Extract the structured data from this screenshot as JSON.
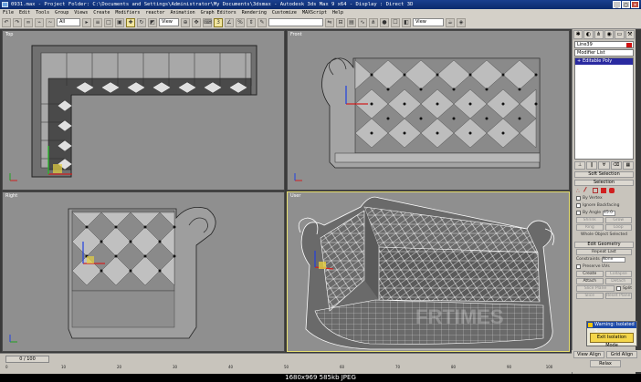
{
  "window": {
    "title": "0931.max  - Project Folder: C:\\Documents and Settings\\Administrator\\My Documents\\3dsmax  - Autodesk 3ds Max 9 x64  - Display : Direct 3D",
    "min": "_",
    "max": "□",
    "close": "×"
  },
  "menu": [
    "File",
    "Edit",
    "Tools",
    "Group",
    "Views",
    "Create",
    "Modifiers",
    "reactor",
    "Animation",
    "Graph Editors",
    "Rendering",
    "Customize",
    "MAXScript",
    "Help"
  ],
  "toolbar": {
    "selection_filter": "All",
    "ref_coord": "View",
    "named_sel": "",
    "ref_coord_2": "View"
  },
  "viewports": {
    "top": "Top",
    "front": "Front",
    "left": "Right",
    "perspective": "User"
  },
  "command_panel": {
    "object_name": "Line39",
    "modifier_list": "Modifier List",
    "stack_item": "Editable Poly",
    "rollouts": {
      "soft_selection": "Soft Selection",
      "selection": "Selection",
      "by_vertex": "By Vertex",
      "ignore_backfacing": "Ignore Backfacing",
      "by_angle": "By Angle",
      "angle_value": "45.0",
      "shrink": "Shrink",
      "grow": "Grow",
      "ring": "Ring",
      "loop": "Loop",
      "whole_object": "Whole Object Selected",
      "edit_geometry": "Edit Geometry",
      "repeat_last": "Repeat Last",
      "constraints": "Constraints",
      "constraints_value": "None",
      "preserve_uvs": "Preserve UVs",
      "create": "Create",
      "collapse": "Collapse",
      "attach": "Attach",
      "detach": "Detach",
      "slice_plane": "Slice Plane",
      "split": "Split",
      "slice": "Slice",
      "reset_plane": "Reset Plane"
    }
  },
  "warning": {
    "title": "Warning: Isolated S...",
    "exit": "Exit Isolation Mode"
  },
  "bottom_buttons": {
    "view_align": "View Align",
    "grid_align": "Grid Align",
    "relax": "Relax"
  },
  "timeline": {
    "frame": "0 / 100",
    "ticks": [
      "0",
      "10",
      "20",
      "30",
      "40",
      "50",
      "60",
      "70",
      "80",
      "90",
      "100"
    ]
  },
  "watermark": "FRTIMES",
  "caption": "1680x969  585kb  JPEG"
}
